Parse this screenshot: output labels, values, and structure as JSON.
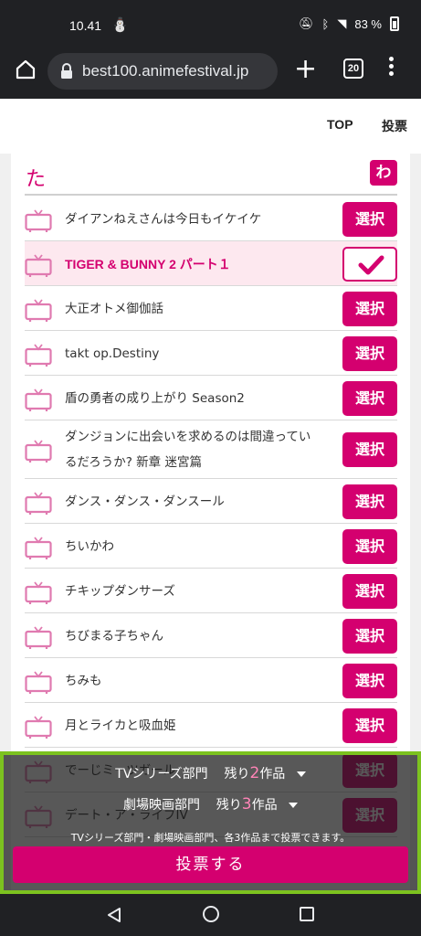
{
  "status": {
    "time": "10.41",
    "battery": "83 %",
    "colors": {
      "background": "#202124",
      "foreground": "#ffffff"
    }
  },
  "browser": {
    "url": "best100.animefestival.jp",
    "tab_count": "20",
    "icons": [
      "home-icon",
      "lock-icon",
      "new-tab-icon",
      "tabs-icon",
      "more-menu-icon"
    ]
  },
  "nav": {
    "top_label": "TOP",
    "vote_label": "投票"
  },
  "section": {
    "kana": "た",
    "next_kana": "わ"
  },
  "list": {
    "select_label": "選択",
    "items": [
      {
        "title": "ダイアンねえさんは今日もイケイケ",
        "selected": false
      },
      {
        "title": "TIGER & BUNNY 2 パート１",
        "selected": true
      },
      {
        "title": "大正オトメ御伽話",
        "selected": false
      },
      {
        "title": "takt op.Destiny",
        "selected": false
      },
      {
        "title": "盾の勇者の成り上がり Season2",
        "selected": false
      },
      {
        "title": "ダンジョンに出会いを求めるのは間違っているだろうか? 新章 迷宮篇",
        "selected": false
      },
      {
        "title": "ダンス・ダンス・ダンスール",
        "selected": false
      },
      {
        "title": "ちいかわ",
        "selected": false
      },
      {
        "title": "チキップダンサーズ",
        "selected": false
      },
      {
        "title": "ちびまる子ちゃん",
        "selected": false
      },
      {
        "title": "ちみも",
        "selected": false
      },
      {
        "title": "月とライカと吸血姫",
        "selected": false
      },
      {
        "title": "でーじミーツガール",
        "selected": false
      },
      {
        "title": "デート・ア・ライブIV",
        "selected": false
      }
    ]
  },
  "vote_panel": {
    "tv_label": "TVシリーズ部門",
    "movie_label": "劇場映画部門",
    "remaining_prefix": "残り",
    "tv_remaining": "2",
    "movie_remaining": "3",
    "unit": "作品",
    "note": "TVシリーズ部門・劇場映画部門、各3作品まで投票できます。",
    "vote_button": "投票する"
  },
  "theme": {
    "accent": "#d4006f",
    "highlight_border": "#7cc21f",
    "selected_row": "#fde8ef"
  }
}
